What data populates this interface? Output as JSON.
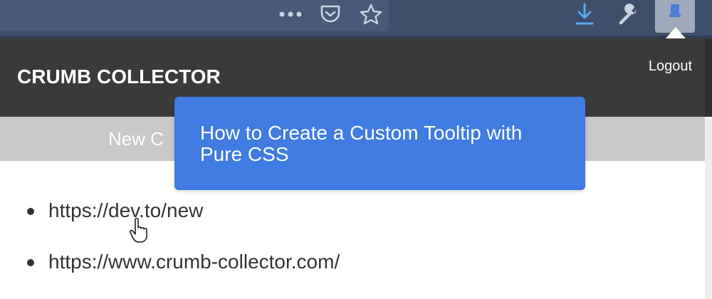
{
  "browser": {
    "icons": [
      "more-icon",
      "pocket-icon",
      "bookmark-star-icon",
      "download-icon",
      "wrench-icon",
      "extension-icon"
    ]
  },
  "app": {
    "title": "CRUMB COLLECTOR",
    "logout_label": "Logout"
  },
  "tab": {
    "label": "New C"
  },
  "tooltip": {
    "text": "How to Create a Custom Tooltip with Pure CSS",
    "background": "#3f7be0"
  },
  "urls": [
    "https://dev.to/new",
    "https://www.crumb-collector.com/"
  ],
  "colors": {
    "toolbar": "#3d4f6a",
    "header": "#3a3a3a",
    "tab_bar": "#c8c8c8",
    "accent_icon": "#5aa9f0"
  }
}
